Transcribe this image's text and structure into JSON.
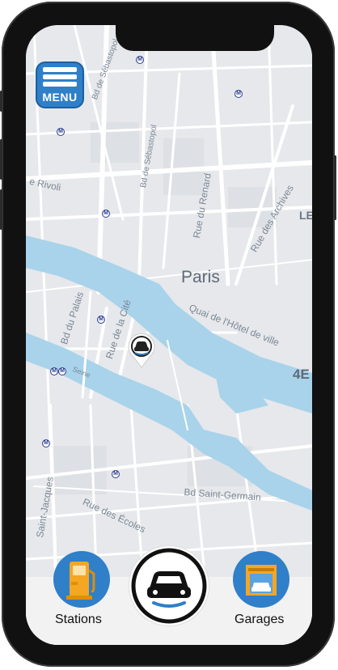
{
  "menu": {
    "label": "MENU"
  },
  "map": {
    "city_label": "Paris",
    "streets": {
      "rivoli": "e Rivoli",
      "bd_sebastopol": "Bd de Sébastopol",
      "rue_du_renard": "Rue du Renard",
      "rue_des_archives": "Rue des Archives",
      "quai": "Quai de l'Hôtel de ville",
      "bd_du_palais": "Bd du Palais",
      "rue_de_la_cite": "Rue de la Cité",
      "seine": "Seine",
      "bd_saint_germain": "Bd Saint-Germain",
      "rue_des_ecoles": "Rue des Écoles",
      "saint_jacques": "Saint-Jacques",
      "le_label": "LE",
      "arr_label": "4E"
    },
    "metro_glyph": "M"
  },
  "tabs": {
    "stations": "Stations",
    "garages": "Garages"
  },
  "colors": {
    "accent": "#2f7fc9",
    "water": "#a8d3ea",
    "land": "#e6e8eb"
  },
  "icons": {
    "menu": "menu-icon",
    "car_pin": "car-pin-icon",
    "fuel_pump": "fuel-pump-icon",
    "garage": "garage-icon",
    "car": "car-icon"
  }
}
